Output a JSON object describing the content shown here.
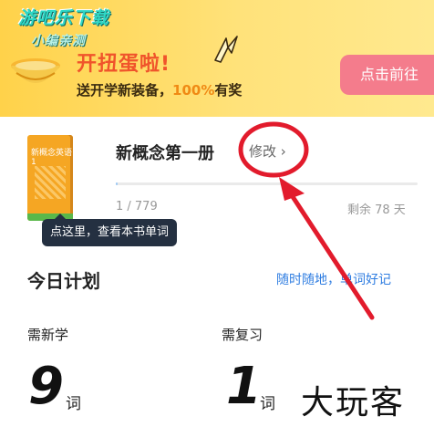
{
  "banner": {
    "watermark_line1": "游吧乐下载",
    "watermark_line2": "小编亲测",
    "title": "开扭蛋啦!",
    "subtitle_prefix": "送开学新装备，",
    "subtitle_highlight": "100%",
    "subtitle_suffix": "有奖",
    "cta_label": "点击前往"
  },
  "book": {
    "cover_title": "新概念英语1",
    "name": "新概念第一册",
    "edit_label": "修改",
    "progress_text": "1 / 779",
    "progress_fraction": 0.0013,
    "remaining": "剩余 78 天",
    "tooltip": "点这里，查看本书单词"
  },
  "plan": {
    "title": "今日计划",
    "slogan": "随时随地，单词好记",
    "new_label": "需新学",
    "new_count": "9",
    "review_label": "需复习",
    "review_count": "1",
    "unit": "词"
  },
  "watermark_bottom": "大玩客",
  "colors": {
    "banner_yellow": "#ffd24a",
    "promo_red": "#f0542b",
    "cta_pink": "#f47c8c",
    "link_blue": "#2f7de1",
    "annotation_red": "#e21b2c",
    "tooltip_bg": "#243041"
  }
}
